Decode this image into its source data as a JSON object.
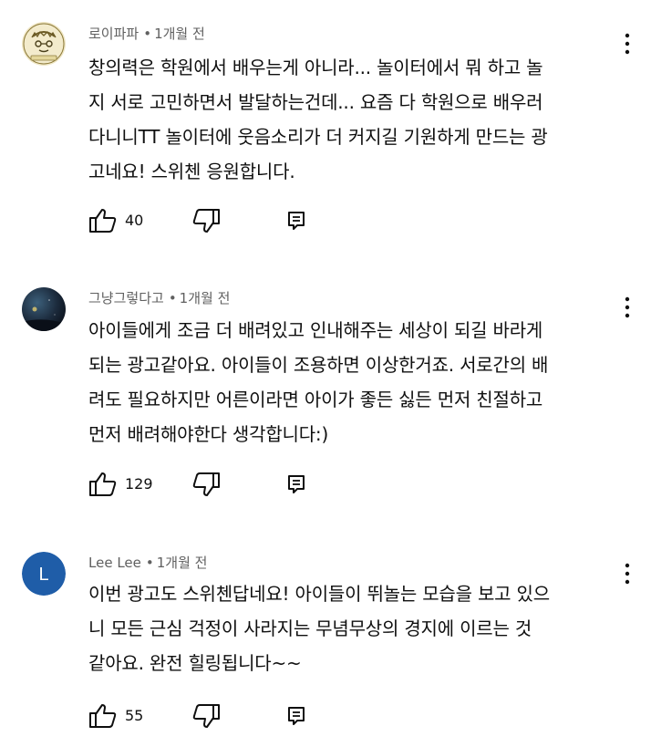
{
  "comments": [
    {
      "author": "로이파파",
      "separator": "•",
      "time": "1개월 전",
      "text": "창의력은 학원에서 배우는게 아니라... 놀이터에서 뭐 하고 놀\n지 서로 고민하면서 발달하는건데... 요즘 다 학원으로 배우러\n다니니TT  놀이터에 웃음소리가 더 커지길 기원하게 만드는 광\n고네요! 스위첸 응원합니다.",
      "likes": "40",
      "avatar_icon": "cartoon-face-avatar"
    },
    {
      "author": "그냥그렇다고",
      "separator": "•",
      "time": "1개월 전",
      "text": "아이들에게 조금 더 배려있고 인내해주는 세상이 되길 바라게\n되는 광고같아요. 아이들이 조용하면 이상한거죠. 서로간의 배\n려도 필요하지만 어른이라면 아이가 좋든 싫든 먼저 친절하고\n먼저 배려해야한다 생각합니다:)",
      "likes": "129",
      "avatar_icon": "night-sky-avatar"
    },
    {
      "author": "Lee Lee",
      "separator": "•",
      "time": "1개월 전",
      "text": "이번 광고도 스위첸답네요! 아이들이 뛰놀는 모습을 보고 있으\n니  모든 근심 걱정이 사라지는 무념무상의 경지에 이르는 것\n같아요. 완전 힐링됩니다~~",
      "likes": "55",
      "avatar_letter": "L",
      "avatar_color": "#1f5da8"
    }
  ],
  "icons": {
    "like": "thumbs-up-icon",
    "dislike": "thumbs-down-icon",
    "reply": "reply-icon",
    "menu": "more-vert-icon"
  }
}
